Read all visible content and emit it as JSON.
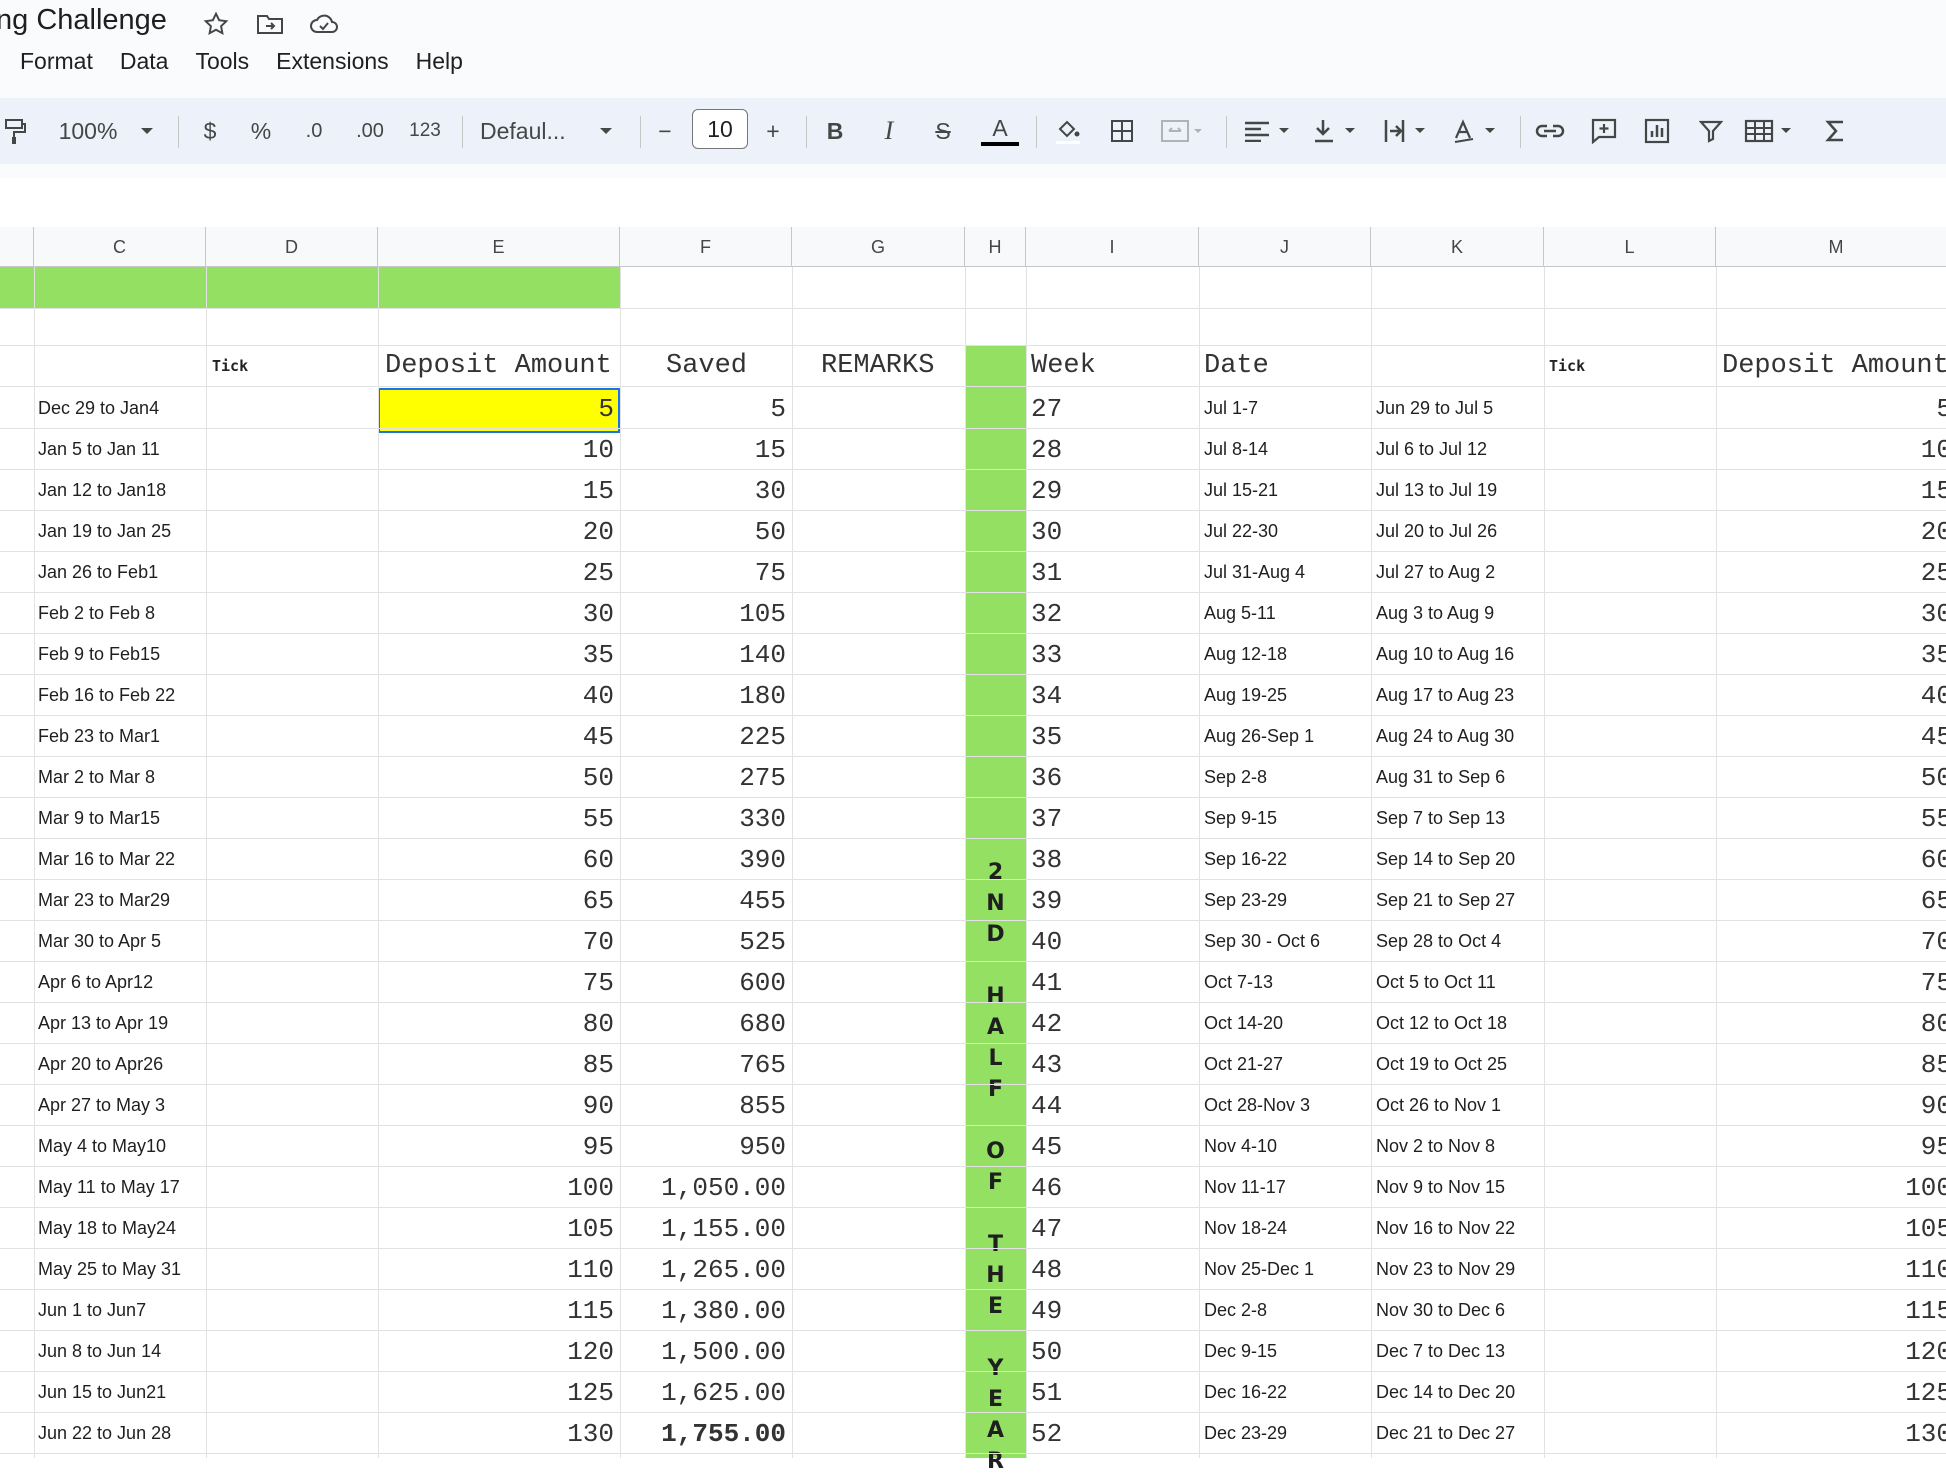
{
  "doc": {
    "title": "ng Challenge",
    "icons": [
      "star-icon",
      "move-folder-icon",
      "cloud-status-icon"
    ]
  },
  "menu": [
    "Format",
    "Data",
    "Tools",
    "Extensions",
    "Help"
  ],
  "toolbar": {
    "zoom": "100%",
    "currency": "$",
    "percent": "%",
    "dec_decrease": ".0",
    "dec_increase": ".00",
    "number_format": "123",
    "font": "Defaul...",
    "font_size": "10",
    "minus": "−",
    "plus": "+",
    "bold": "B",
    "italic": "I",
    "strike": "S",
    "text_color": "A"
  },
  "columns": [
    "C",
    "D",
    "E",
    "F",
    "G",
    "H",
    "I",
    "J",
    "K",
    "L",
    "M"
  ],
  "headers": {
    "tick": "Tick",
    "deposit": "Deposit Amount",
    "saved": "Saved",
    "remarks": "REMARKS",
    "week": "Week",
    "date": "Date",
    "tick2": "Tick",
    "deposit2": "Deposit Amount"
  },
  "vertical_label": [
    "2",
    "N",
    "D",
    "",
    "H",
    "A",
    "L",
    "F",
    "",
    "O",
    "F",
    "",
    "T",
    "H",
    "E",
    "",
    "Y",
    "E",
    "A",
    "R"
  ],
  "colors": {
    "green": "#93e063",
    "yellow": "#ffff00"
  },
  "left_rows": [
    {
      "c": "Dec 29 to Jan4",
      "e": "5",
      "f": "5"
    },
    {
      "c": "Jan 5 to Jan 11",
      "e": "10",
      "f": "15"
    },
    {
      "c": "Jan 12 to Jan18",
      "e": "15",
      "f": "30"
    },
    {
      "c": "Jan 19 to Jan 25",
      "e": "20",
      "f": "50"
    },
    {
      "c": "Jan 26 to Feb1",
      "e": "25",
      "f": "75"
    },
    {
      "c": "Feb 2 to Feb 8",
      "e": "30",
      "f": "105"
    },
    {
      "c": "Feb 9 to Feb15",
      "e": "35",
      "f": "140"
    },
    {
      "c": "Feb 16 to Feb 22",
      "e": "40",
      "f": "180"
    },
    {
      "c": "Feb 23 to Mar1",
      "e": "45",
      "f": "225"
    },
    {
      "c": "Mar 2 to Mar 8",
      "e": "50",
      "f": "275"
    },
    {
      "c": "Mar 9 to Mar15",
      "e": "55",
      "f": "330"
    },
    {
      "c": "Mar 16 to Mar 22",
      "e": "60",
      "f": "390"
    },
    {
      "c": "Mar 23 to Mar29",
      "e": "65",
      "f": "455"
    },
    {
      "c": "Mar 30 to Apr 5",
      "e": "70",
      "f": "525"
    },
    {
      "c": "Apr 6 to Apr12",
      "e": "75",
      "f": "600"
    },
    {
      "c": "Apr 13 to Apr 19",
      "e": "80",
      "f": "680"
    },
    {
      "c": "Apr 20 to Apr26",
      "e": "85",
      "f": "765"
    },
    {
      "c": "Apr 27 to May 3",
      "e": "90",
      "f": "855"
    },
    {
      "c": "May 4 to May10",
      "e": "95",
      "f": "950"
    },
    {
      "c": "May 11 to May 17",
      "e": "100",
      "f": "1,050.00"
    },
    {
      "c": "May 18 to May24",
      "e": "105",
      "f": "1,155.00"
    },
    {
      "c": "May 25 to May 31",
      "e": "110",
      "f": "1,265.00"
    },
    {
      "c": "Jun 1 to Jun7",
      "e": "115",
      "f": "1,380.00"
    },
    {
      "c": "Jun 8 to Jun 14",
      "e": "120",
      "f": "1,500.00"
    },
    {
      "c": "Jun 15 to Jun21",
      "e": "125",
      "f": "1,625.00"
    },
    {
      "c": "Jun 22 to Jun 28",
      "e": "130",
      "f": "1,755.00"
    }
  ],
  "right_rows": [
    {
      "week": "27",
      "j": "Jul 1-7",
      "k": "Jun 29 to Jul 5",
      "m": "5"
    },
    {
      "week": "28",
      "j": "Jul 8-14",
      "k": "Jul 6 to Jul 12",
      "m": "10"
    },
    {
      "week": "29",
      "j": "Jul 15-21",
      "k": "Jul 13 to Jul 19",
      "m": "15"
    },
    {
      "week": "30",
      "j": "Jul 22-30",
      "k": "Jul 20 to Jul 26",
      "m": "20"
    },
    {
      "week": "31",
      "j": "Jul 31-Aug 4",
      "k": "Jul 27 to Aug 2",
      "m": "25"
    },
    {
      "week": "32",
      "j": "Aug 5-11",
      "k": "Aug 3 to Aug 9",
      "m": "30"
    },
    {
      "week": "33",
      "j": "Aug 12-18",
      "k": "Aug 10 to Aug 16",
      "m": "35"
    },
    {
      "week": "34",
      "j": "Aug 19-25",
      "k": "Aug 17 to Aug 23",
      "m": "40"
    },
    {
      "week": "35",
      "j": "Aug 26-Sep 1",
      "k": "Aug 24 to Aug 30",
      "m": "45"
    },
    {
      "week": "36",
      "j": "Sep 2-8",
      "k": "Aug 31 to Sep 6",
      "m": "50"
    },
    {
      "week": "37",
      "j": "Sep 9-15",
      "k": "Sep 7 to Sep 13",
      "m": "55"
    },
    {
      "week": "38",
      "j": "Sep 16-22",
      "k": "Sep 14 to Sep 20",
      "m": "60"
    },
    {
      "week": "39",
      "j": "Sep 23-29",
      "k": "Sep 21 to Sep 27",
      "m": "65"
    },
    {
      "week": "40",
      "j": "Sep 30 - Oct 6",
      "k": "Sep 28 to Oct 4",
      "m": "70"
    },
    {
      "week": "41",
      "j": "Oct 7-13",
      "k": "Oct 5 to Oct 11",
      "m": "75"
    },
    {
      "week": "42",
      "j": "Oct 14-20",
      "k": "Oct 12 to Oct 18",
      "m": "80"
    },
    {
      "week": "43",
      "j": "Oct 21-27",
      "k": "Oct 19 to Oct 25",
      "m": "85"
    },
    {
      "week": "44",
      "j": "Oct 28-Nov 3",
      "k": "Oct 26 to Nov 1",
      "m": "90"
    },
    {
      "week": "45",
      "j": "Nov 4-10",
      "k": "Nov 2 to Nov 8",
      "m": "95"
    },
    {
      "week": "46",
      "j": "Nov 11-17",
      "k": "Nov 9 to Nov 15",
      "m": "100"
    },
    {
      "week": "47",
      "j": "Nov 18-24",
      "k": "Nov 16 to Nov 22",
      "m": "105"
    },
    {
      "week": "48",
      "j": "Nov 25-Dec 1",
      "k": "Nov 23 to Nov 29",
      "m": "110"
    },
    {
      "week": "49",
      "j": "Dec 2-8",
      "k": "Nov 30 to Dec 6",
      "m": "115"
    },
    {
      "week": "50",
      "j": "Dec 9-15",
      "k": "Dec 7 to Dec 13",
      "m": "120"
    },
    {
      "week": "51",
      "j": "Dec 16-22",
      "k": "Dec 14 to Dec 20",
      "m": "125"
    },
    {
      "week": "52",
      "j": "Dec 23-29",
      "k": "Dec 21 to Dec 27",
      "m": "130"
    }
  ]
}
